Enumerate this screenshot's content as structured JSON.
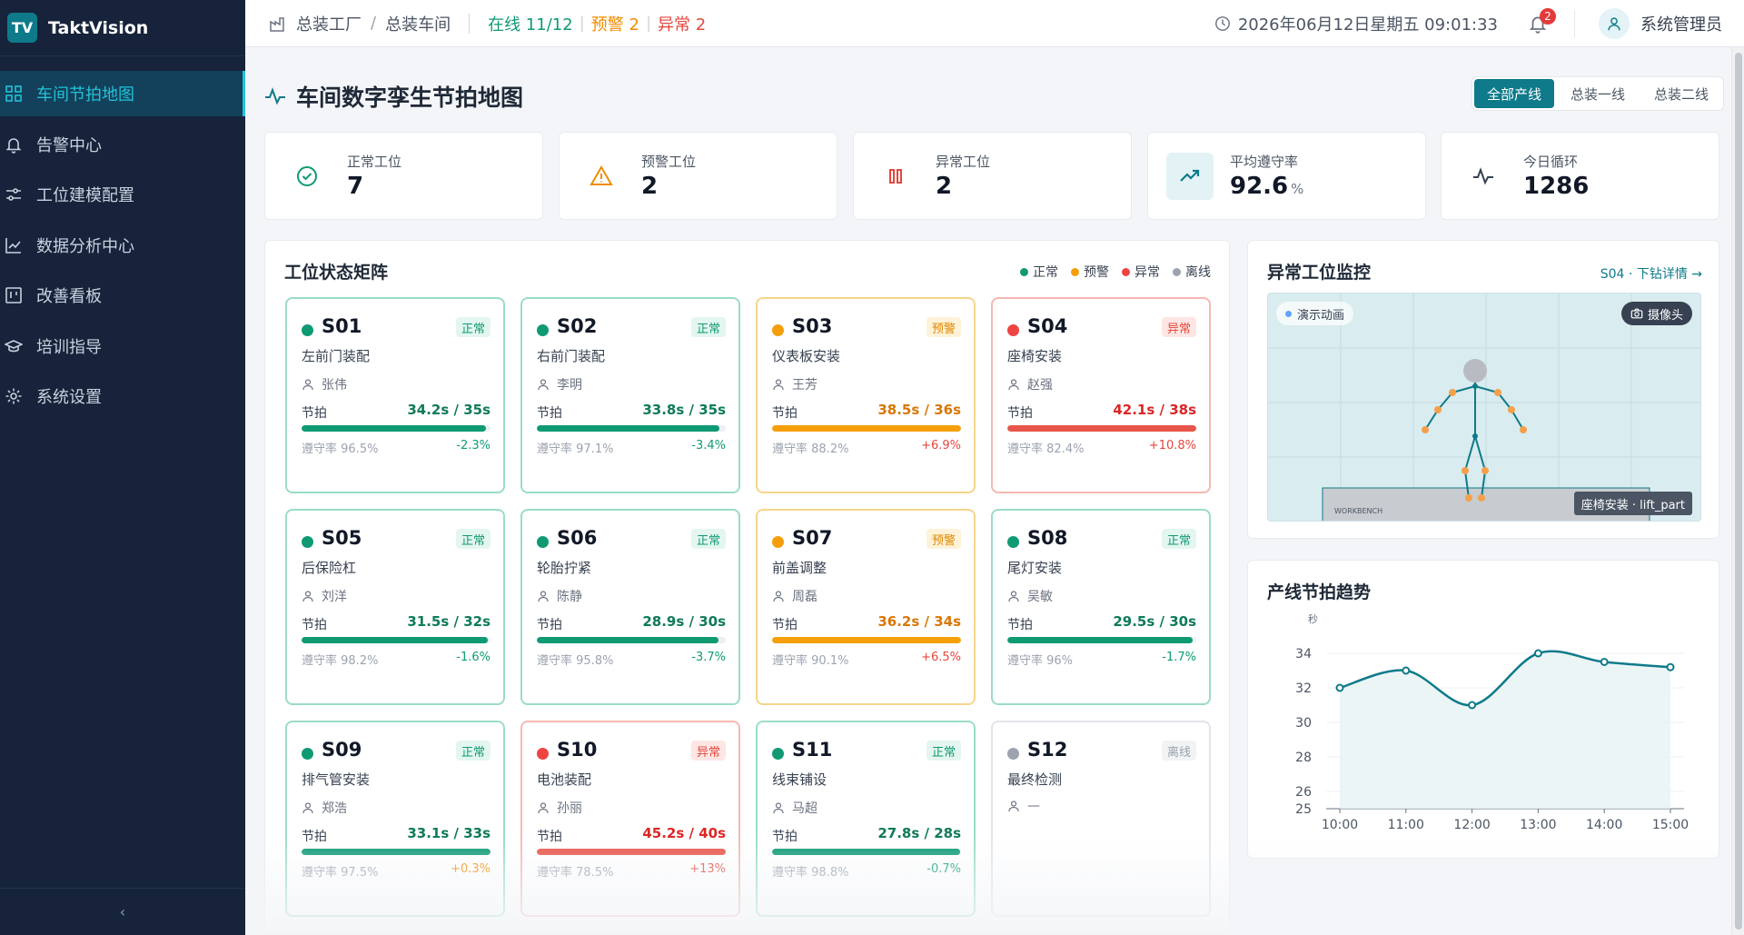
{
  "app": {
    "logo_abbr": "TV",
    "name": "TaktVision"
  },
  "sidebar": {
    "items": [
      {
        "label": "车间节拍地图",
        "icon": "grid-icon",
        "active": true
      },
      {
        "label": "告警中心",
        "icon": "bell-icon",
        "active": false
      },
      {
        "label": "工位建模配置",
        "icon": "sliders-icon",
        "active": false
      },
      {
        "label": "数据分析中心",
        "icon": "line-chart-icon",
        "active": false
      },
      {
        "label": "改善看板",
        "icon": "kanban-icon",
        "active": false
      },
      {
        "label": "培训指导",
        "icon": "graduation-cap-icon",
        "active": false
      },
      {
        "label": "系统设置",
        "icon": "gear-icon",
        "active": false
      }
    ],
    "collapse_label": "‹"
  },
  "topbar": {
    "breadcrumb": [
      "总装工厂",
      "总装车间"
    ],
    "online": "在线 11/12",
    "warning": "预警 2",
    "abnormal": "异常 2",
    "datetime": "2026年06月12日星期五 09:01:33",
    "notification_count": "2",
    "user": "系统管理员"
  },
  "page": {
    "title": "车间数字孪生节拍地图",
    "line_tabs": [
      {
        "label": "全部产线",
        "active": true
      },
      {
        "label": "总装一线",
        "active": false
      },
      {
        "label": "总装二线",
        "active": false
      }
    ]
  },
  "kpis": [
    {
      "label": "正常工位",
      "value": "7",
      "unit": "",
      "icon": "check-circle-icon",
      "color": "#0f9a74"
    },
    {
      "label": "预警工位",
      "value": "2",
      "unit": "",
      "icon": "warning-triangle-icon",
      "color": "#f08c00"
    },
    {
      "label": "异常工位",
      "value": "2",
      "unit": "",
      "icon": "pause-bars-icon",
      "color": "#e4473c"
    },
    {
      "label": "平均遵守率",
      "value": "92.6",
      "unit": "%",
      "icon": "trending-up-icon",
      "color": "#0e7a8a"
    },
    {
      "label": "今日循环",
      "value": "1286",
      "unit": "",
      "icon": "pulse-icon",
      "color": "#374151"
    }
  ],
  "matrix": {
    "title": "工位状态矩阵",
    "legend": [
      {
        "label": "正常",
        "color": "#0f9a74"
      },
      {
        "label": "预警",
        "color": "#f59e0b"
      },
      {
        "label": "异常",
        "color": "#ef4444"
      },
      {
        "label": "离线",
        "color": "#9ca3af"
      }
    ],
    "takt_label": "节拍",
    "rate_prefix": "遵守率 ",
    "stations": [
      {
        "code": "S01",
        "status": "正常",
        "kind": "normal",
        "name": "左前门装配",
        "operator": "张伟",
        "takt": "34.2s / 35s",
        "fill": 0.977,
        "rate": "96.5%",
        "delta": "-2.3%"
      },
      {
        "code": "S02",
        "status": "正常",
        "kind": "normal",
        "name": "右前门装配",
        "operator": "李明",
        "takt": "33.8s / 35s",
        "fill": 0.966,
        "rate": "97.1%",
        "delta": "-3.4%"
      },
      {
        "code": "S03",
        "status": "预警",
        "kind": "warning",
        "name": "仪表板安装",
        "operator": "王芳",
        "takt": "38.5s / 36s",
        "fill": 1,
        "rate": "88.2%",
        "delta": "+6.9%"
      },
      {
        "code": "S04",
        "status": "异常",
        "kind": "abnormal",
        "name": "座椅安装",
        "operator": "赵强",
        "takt": "42.1s / 38s",
        "fill": 1,
        "rate": "82.4%",
        "delta": "+10.8%"
      },
      {
        "code": "S05",
        "status": "正常",
        "kind": "normal",
        "name": "后保险杠",
        "operator": "刘洋",
        "takt": "31.5s / 32s",
        "fill": 0.984,
        "rate": "98.2%",
        "delta": "-1.6%"
      },
      {
        "code": "S06",
        "status": "正常",
        "kind": "normal",
        "name": "轮胎拧紧",
        "operator": "陈静",
        "takt": "28.9s / 30s",
        "fill": 0.963,
        "rate": "95.8%",
        "delta": "-3.7%"
      },
      {
        "code": "S07",
        "status": "预警",
        "kind": "warning",
        "name": "前盖调整",
        "operator": "周磊",
        "takt": "36.2s / 34s",
        "fill": 1,
        "rate": "90.1%",
        "delta": "+6.5%"
      },
      {
        "code": "S08",
        "status": "正常",
        "kind": "normal",
        "name": "尾灯安装",
        "operator": "吴敏",
        "takt": "29.5s / 30s",
        "fill": 0.983,
        "rate": "96%",
        "delta": "-1.7%"
      },
      {
        "code": "S09",
        "status": "正常",
        "kind": "normal",
        "name": "排气管安装",
        "operator": "郑浩",
        "takt": "33.1s / 33s",
        "fill": 1,
        "rate": "97.5%",
        "delta": "+0.3%"
      },
      {
        "code": "S10",
        "status": "异常",
        "kind": "abnormal",
        "name": "电池装配",
        "operator": "孙丽",
        "takt": "45.2s / 40s",
        "fill": 1,
        "rate": "78.5%",
        "delta": "+13%"
      },
      {
        "code": "S11",
        "status": "正常",
        "kind": "normal",
        "name": "线束铺设",
        "operator": "马超",
        "takt": "27.8s / 28s",
        "fill": 0.993,
        "rate": "98.8%",
        "delta": "-0.7%"
      },
      {
        "code": "S12",
        "status": "离线",
        "kind": "offline",
        "name": "最终检测",
        "operator": "—",
        "takt": "",
        "fill": 0,
        "rate": "",
        "delta": ""
      }
    ]
  },
  "monitor": {
    "title": "异常工位监控",
    "drill_link": "S04 · 下钻详情 →",
    "demo_label": "演示动画",
    "camera_label": "摄像头",
    "action_tag": "座椅安装 · lift_part",
    "workbench_label": "WORKBENCH"
  },
  "trend": {
    "title": "产线节拍趋势"
  },
  "chart_data": {
    "type": "line",
    "title": "产线节拍趋势",
    "ylabel": "秒",
    "xlabel": "",
    "categories": [
      "10:00",
      "11:00",
      "12:00",
      "13:00",
      "14:00",
      "15:00"
    ],
    "values": [
      32,
      33,
      31,
      34,
      33.5,
      33.2
    ],
    "y_ticks": [
      25,
      26,
      28,
      30,
      32,
      34
    ],
    "ylim": [
      25,
      35
    ],
    "grid": true,
    "color": "#0e7a8a"
  }
}
